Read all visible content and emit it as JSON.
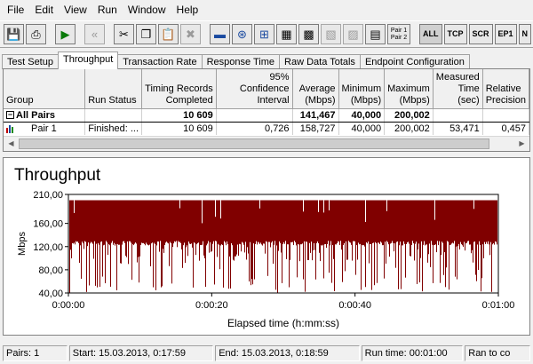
{
  "menu": [
    "File",
    "Edit",
    "View",
    "Run",
    "Window",
    "Help"
  ],
  "toolbar": {
    "icons": [
      "save-icon",
      "print-icon",
      "run-icon",
      "back-icon",
      "cut-icon",
      "copy-icon",
      "paste-icon",
      "delete-icon",
      "pair-icon",
      "multicast-icon",
      "network-icon",
      "grid-icon",
      "grid-bold-icon",
      "mesh-icon",
      "mesh-dim-icon",
      "mesh-alt-icon"
    ],
    "pair_top": "Pair 1",
    "pair_bottom": "Pair 2",
    "all_label": "ALL",
    "tcp_label": "TCP",
    "scr_label": "SCR",
    "ep1_label": "EP1",
    "n_label": "N"
  },
  "tabs": [
    "Test Setup",
    "Throughput",
    "Transaction Rate",
    "Response Time",
    "Raw Data Totals",
    "Endpoint Configuration"
  ],
  "active_tab": "Throughput",
  "table": {
    "headers": [
      "Group",
      "Run Status",
      "Timing Records Completed",
      "95% Confidence Interval",
      "Average (Mbps)",
      "Minimum (Mbps)",
      "Maximum (Mbps)",
      "Measured Time (sec)",
      "Relative Precision"
    ],
    "all_pairs": {
      "group": "All Pairs",
      "expander": "−",
      "records": "10 609",
      "interval": "",
      "average": "141,467",
      "minimum": "40,000",
      "maximum": "200,002",
      "time": "",
      "precision": ""
    },
    "rows": [
      {
        "group": "Pair 1",
        "status": "Finished: ...",
        "records": "10 609",
        "interval": "0,726",
        "average": "158,727",
        "minimum": "40,000",
        "maximum": "200,002",
        "time": "53,471",
        "precision": "0,457"
      }
    ]
  },
  "chart_data": {
    "type": "area",
    "title": "Throughput",
    "xlabel": "Elapsed time (h:mm:ss)",
    "ylabel": "Mbps",
    "x_ticks": [
      "0:00:00",
      "0:00:20",
      "0:00:40",
      "0:01:00"
    ],
    "y_ticks": [
      "40,00",
      "80,00",
      "120,00",
      "160,00",
      "210,00"
    ],
    "ylim": [
      40,
      210
    ],
    "xlim_sec": [
      0,
      60
    ],
    "baseline_value": 200,
    "typical_floor": 130,
    "min_value": 40,
    "max_value": 200.002,
    "color": "#800000"
  },
  "status": {
    "pairs": "Pairs: 1",
    "start": "Start: 15.03.2013, 0:17:59",
    "end": "End: 15.03.2013, 0:18:59",
    "run_time": "Run time: 00:01:00",
    "ran_to": "Ran to co"
  }
}
